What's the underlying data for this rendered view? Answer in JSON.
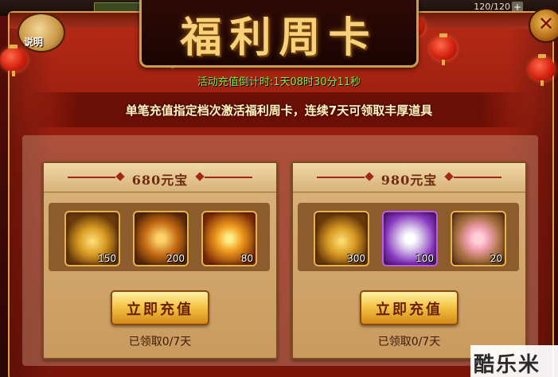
{
  "hud": {
    "hp": "120/120"
  },
  "window": {
    "title": "福利周卡",
    "help_label": "说明",
    "close_icon": "close-icon",
    "countdown": "活动充值倒计时:1天08时30分11秒",
    "description": "单笔充值指定档次激活福利周卡，连续7天可领取丰厚道具"
  },
  "cards": [
    {
      "price": "680元宝",
      "items": [
        {
          "icon": "gold-ingot-icon",
          "qty": "150"
        },
        {
          "icon": "pentagram-icon",
          "qty": "200"
        },
        {
          "icon": "fire-orb-icon",
          "qty": "80"
        }
      ],
      "button_label": "立即充值",
      "status": "已领取0/7天"
    },
    {
      "price": "980元宝",
      "items": [
        {
          "icon": "gold-ingot-icon",
          "qty": "300"
        },
        {
          "icon": "white-powder-icon",
          "qty": "100"
        },
        {
          "icon": "pink-powder-icon",
          "qty": "20"
        }
      ],
      "button_label": "立即充值",
      "status": "已领取0/7天"
    }
  ],
  "watermark": "酷乐米",
  "colors": {
    "accent_gold": "#f7d27a",
    "countdown_green": "#79e84a",
    "panel_red": "#8f1a0c"
  }
}
